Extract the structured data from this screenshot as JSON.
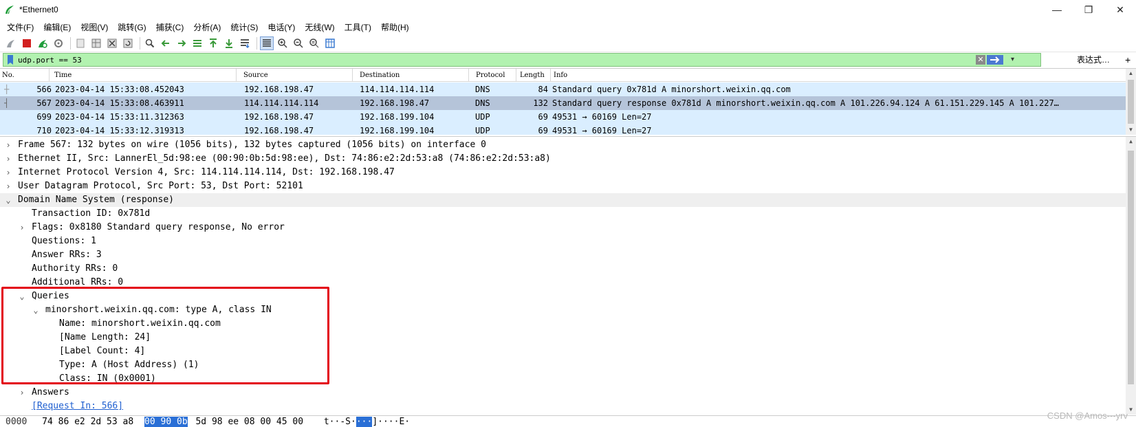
{
  "window": {
    "title": "*Ethernet0",
    "minimize": "—",
    "maximize": "❐",
    "close": "✕"
  },
  "menu": [
    "文件(F)",
    "编辑(E)",
    "视图(V)",
    "跳转(G)",
    "捕获(C)",
    "分析(A)",
    "统计(S)",
    "电话(Y)",
    "无线(W)",
    "工具(T)",
    "帮助(H)"
  ],
  "filter": {
    "value": "udp.port == 53",
    "expression_label": "表达式…",
    "plus": "+",
    "bg_color": "#b2f2b0"
  },
  "packet_list": {
    "headers": {
      "no": "No.",
      "time": "Time",
      "source": "Source",
      "destination": "Destination",
      "protocol": "Protocol",
      "length": "Length",
      "info": "Info"
    },
    "rows": [
      {
        "no": "566",
        "time": "2023-04-14 15:33:08.452043",
        "source": "192.168.198.47",
        "destination": "114.114.114.114",
        "protocol": "DNS",
        "length": "84",
        "info": "Standard query 0x781d A minorshort.weixin.qq.com"
      },
      {
        "no": "567",
        "time": "2023-04-14 15:33:08.463911",
        "source": "114.114.114.114",
        "destination": "192.168.198.47",
        "protocol": "DNS",
        "length": "132",
        "info": "Standard query response 0x781d A minorshort.weixin.qq.com A 101.226.94.124 A 61.151.229.145 A 101.227…"
      },
      {
        "no": "699",
        "time": "2023-04-14 15:33:11.312363",
        "source": "192.168.198.47",
        "destination": "192.168.199.104",
        "protocol": "UDP",
        "length": "69",
        "info": "49531 → 60169 Len=27"
      },
      {
        "no": "710",
        "time": "2023-04-14 15:33:12.319313",
        "source": "192.168.198.47",
        "destination": "192.168.199.104",
        "protocol": "UDP",
        "length": "69",
        "info": "49531 → 60169 Len=27"
      }
    ]
  },
  "details": {
    "frame": "Frame 567: 132 bytes on wire (1056 bits), 132 bytes captured (1056 bits) on interface 0",
    "ethernet": "Ethernet II, Src: LannerEl_5d:98:ee (00:90:0b:5d:98:ee), Dst: 74:86:e2:2d:53:a8 (74:86:e2:2d:53:a8)",
    "ip": "Internet Protocol Version 4, Src: 114.114.114.114, Dst: 192.168.198.47",
    "udp": "User Datagram Protocol, Src Port: 53, Dst Port: 52101",
    "dns": "Domain Name System (response)",
    "transaction_id": "Transaction ID: 0x781d",
    "flags": "Flags: 0x8180 Standard query response, No error",
    "questions": "Questions: 1",
    "answer_rrs": "Answer RRs: 3",
    "authority_rrs": "Authority RRs: 0",
    "additional_rrs": "Additional RRs: 0",
    "queries": "Queries",
    "query_entry": "minorshort.weixin.qq.com: type A, class IN",
    "name": "Name: minorshort.weixin.qq.com",
    "name_length": "[Name Length: 24]",
    "label_count": "[Label Count: 4]",
    "type": "Type: A (Host Address) (1)",
    "class": "Class: IN (0x0001)",
    "answers": "Answers",
    "request_in": "[Request In: 566]"
  },
  "bytes": {
    "offset": "0000",
    "hex_a": "74 86 e2 2d 53 a8",
    "hex_sel": "00 90 0b",
    "hex_b": "5d 98 ee 08 00 45 00",
    "ascii_a": "t··-S·",
    "ascii_sel": "···",
    "ascii_b": "]····E·"
  },
  "watermark": "CSDN @Amos---yrv",
  "colors": {
    "selected_row": "#b5c4d9",
    "dns_row": "#daeeff",
    "highlight_box": "#e30012"
  }
}
